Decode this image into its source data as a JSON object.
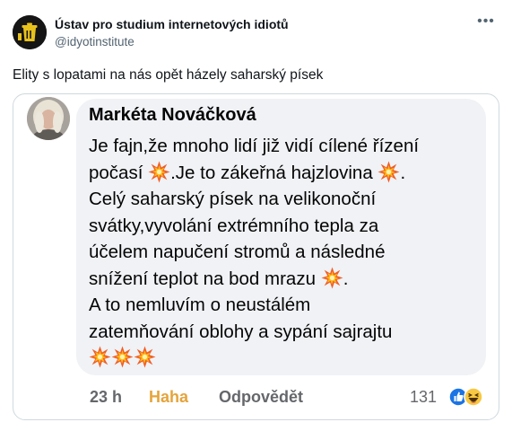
{
  "tweet": {
    "author_name": "Ústav pro studium internetových idiotů",
    "author_handle": "@idyotinstitute",
    "more_icon": "more-dots-icon",
    "text": "Elity s lopatami na nás opět házely saharský písek"
  },
  "comment": {
    "name": "Markéta Nováčková",
    "lines": [
      "Je fajn,že mnoho lidí již vidí cílené řízení",
      "počasí ",
      "Celý saharský písek na velikonoční",
      "svátky,vyvolání extrémního tepla za",
      "účelem napučení stromů a následné",
      "snížení teplot na bod mrazu ",
      "A to nemluvím o neustálém",
      "zatemňování oblohy a sypání sajrajtu"
    ],
    "line2_tail": ".Je to zákeřná hajzlovina ",
    "line2_end": ".",
    "line6_end": ".",
    "emoji_icon": "collision-emoji-icon",
    "time": "23 h",
    "haha": "Haha",
    "reply": "Odpovědět",
    "reaction_count": "131",
    "reaction_icons": [
      "like-reaction-icon",
      "haha-reaction-icon"
    ]
  },
  "colors": {
    "haha_accent": "#e5a43b",
    "like_blue": "#1b74e4",
    "bubble_bg": "#f0f2f5",
    "muted": "#65676b"
  }
}
